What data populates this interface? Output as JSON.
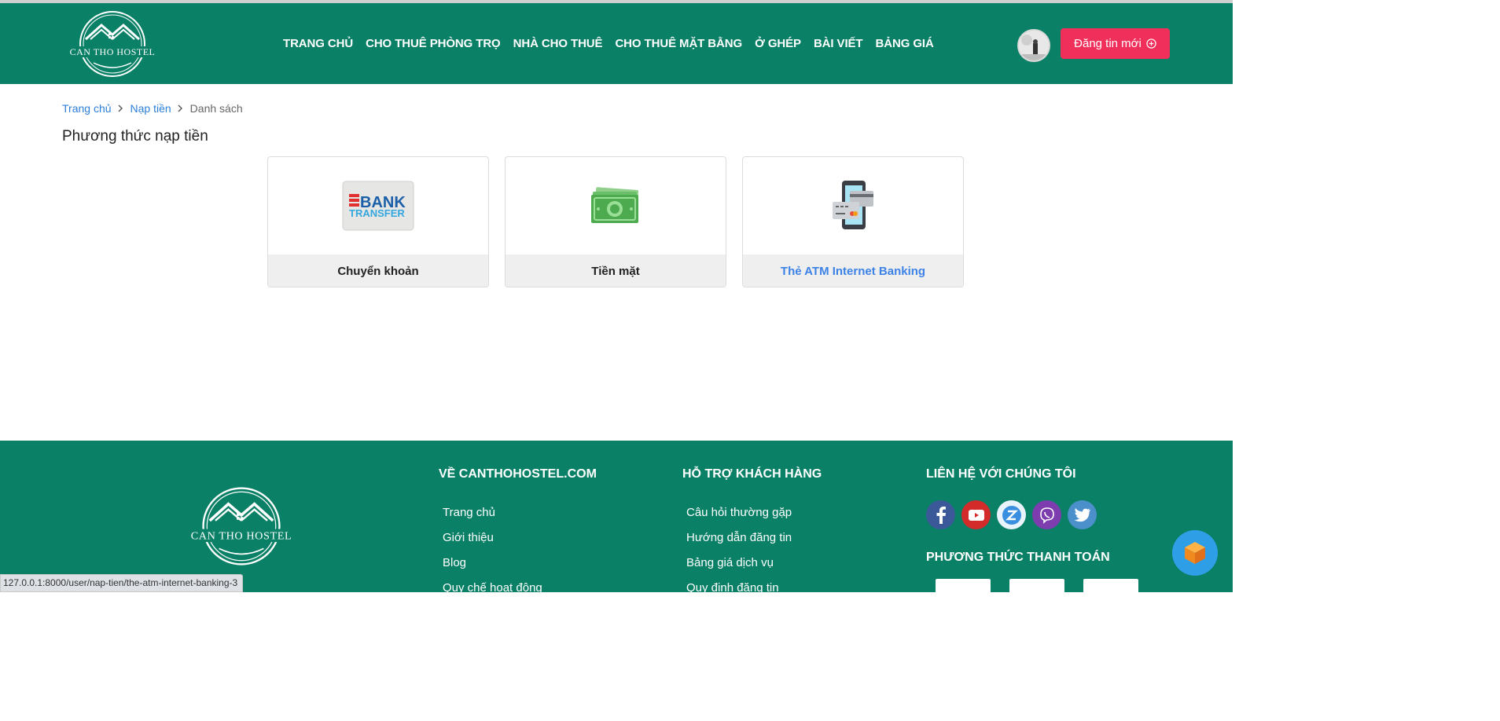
{
  "brand": {
    "logo_text": "CAN THO HOSTEL",
    "primary_color": "#0a8066",
    "accent_color": "#f0305a",
    "link_color": "#2b7fd8"
  },
  "nav": {
    "items": [
      "TRANG CHỦ",
      "CHO THUÊ PHÒNG TRỌ",
      "NHÀ CHO THUÊ",
      "CHO THUÊ MẶT BẰNG",
      "Ở GHÉP",
      "BÀI VIẾT",
      "BẢNG GIÁ"
    ]
  },
  "header": {
    "post_button_label": "Đăng tin mới",
    "post_button_icon": "plus-circle-icon"
  },
  "breadcrumb": {
    "items": [
      "Trang chủ",
      "Nạp tiền"
    ],
    "current": "Danh sách"
  },
  "page": {
    "title": "Phương thức nạp tiền"
  },
  "methods": [
    {
      "label": "Chuyển khoản",
      "icon": "bank-transfer-icon",
      "icon_line1": "BANK",
      "icon_line2": "TRANSFER"
    },
    {
      "label": "Tiền mặt",
      "icon": "cash-icon"
    },
    {
      "label": "Thẻ ATM Internet Banking",
      "icon": "atm-card-phone-icon"
    }
  ],
  "footer": {
    "about": {
      "title": "VỀ CANTHOHOSTEL.COM",
      "links": [
        "Trang chủ",
        "Giới thiệu",
        "Blog",
        "Quy chế hoạt động"
      ]
    },
    "support": {
      "title": "HỖ TRỢ KHÁCH HÀNG",
      "links": [
        "Câu hỏi thường gặp",
        "Hướng dẫn đăng tin",
        "Bảng giá dịch vụ",
        "Quy định đăng tin"
      ]
    },
    "contact": {
      "title": "LIÊN HỆ VỚI CHÚNG TÔI",
      "socials": [
        "facebook-icon",
        "youtube-icon",
        "zalo-icon",
        "viber-icon",
        "twitter-icon"
      ]
    },
    "payment": {
      "title": "PHƯƠNG THỨC THANH TOÁN"
    }
  },
  "status_bar": {
    "url": "127.0.0.1:8000/user/nap-tien/the-atm-internet-banking-3"
  }
}
